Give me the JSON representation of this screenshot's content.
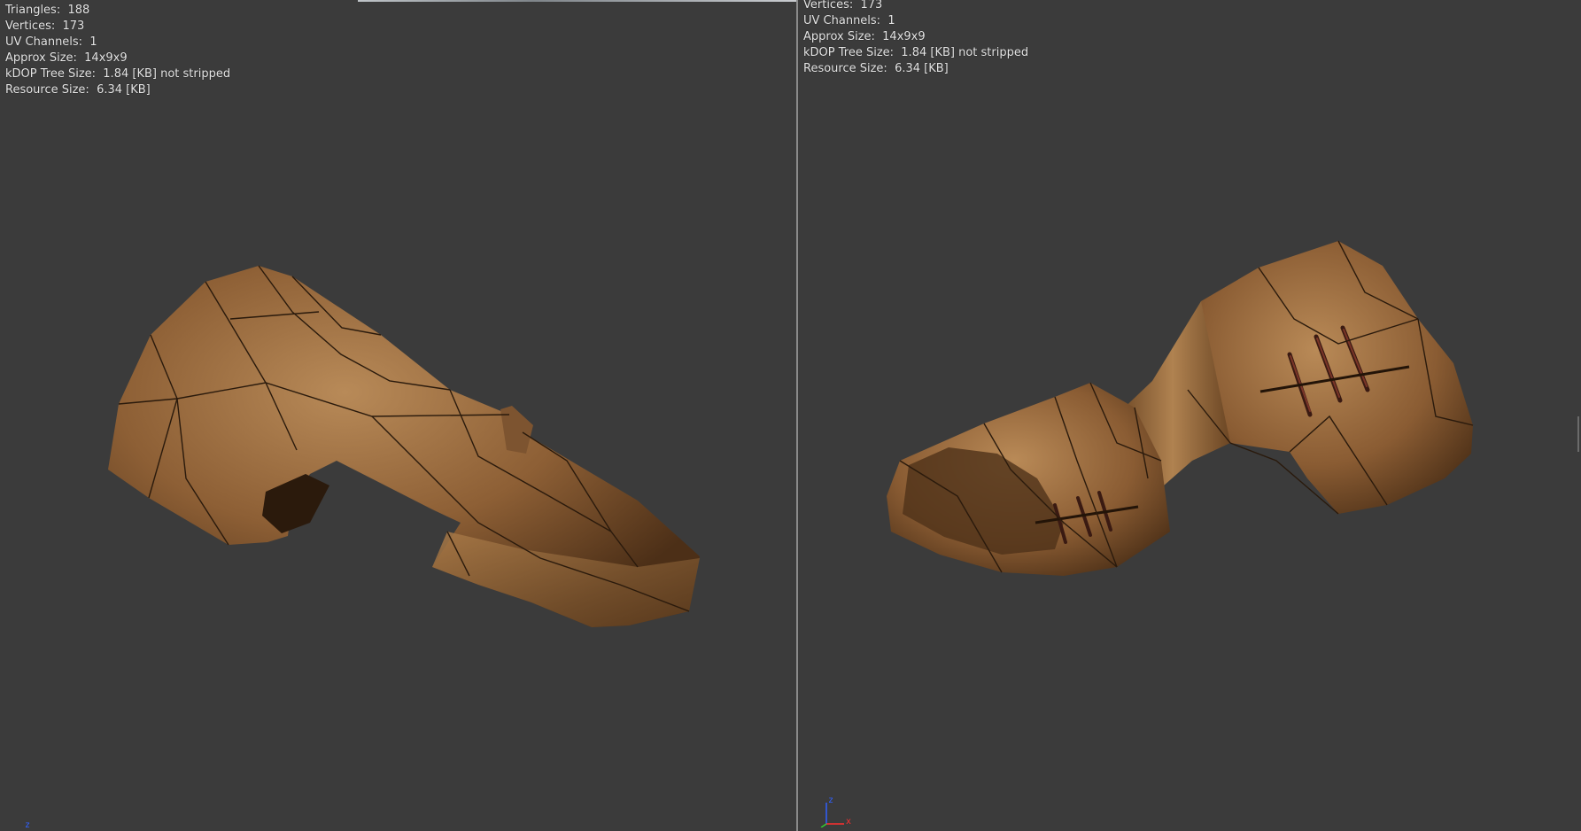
{
  "left_viewport": {
    "stats": [
      "Triangles:  188",
      "Vertices:  173",
      "UV Channels:  1",
      "Approx Size:  14x9x9",
      "kDOP Tree Size:  1.84 [KB] not stripped",
      "Resource Size:  6.34 [KB]"
    ],
    "axis_label": "z"
  },
  "right_viewport": {
    "stats": [
      "Vertices:  173",
      "UV Channels:  1",
      "Approx Size:  14x9x9",
      "kDOP Tree Size:  1.84 [KB] not stripped",
      "Resource Size:  6.34 [KB]"
    ],
    "axis_labels": {
      "z": "z",
      "x": "x"
    }
  },
  "colors": {
    "viewport_bg": "#3b3b3b",
    "leather_dark": "#5c3a1e",
    "leather_mid": "#8b5e35",
    "leather_light": "#b48552",
    "seam": "#2a1a0c",
    "axis_z": "#3060ff",
    "axis_x": "#ff3030",
    "axis_y": "#30d030"
  },
  "icons": [
    "mesh-model-boot-side",
    "mesh-model-boot-front",
    "axis-gizmo-icon"
  ]
}
